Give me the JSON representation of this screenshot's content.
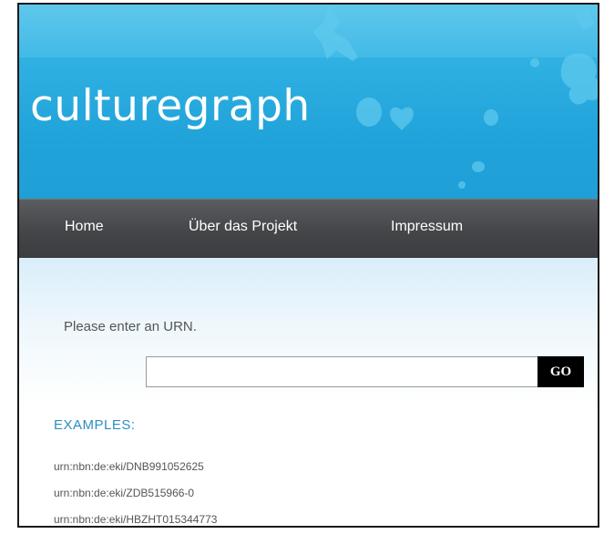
{
  "header": {
    "site_title": "culturegraph"
  },
  "nav": {
    "items": [
      {
        "label": "Home"
      },
      {
        "label": "Über das Projekt"
      },
      {
        "label": "Impressum"
      }
    ]
  },
  "search": {
    "prompt": "Please enter an URN.",
    "value": "",
    "go_label": "GO"
  },
  "examples": {
    "title": "EXAMPLES:",
    "items": [
      {
        "urn": "urn:nbn:de:eki/DNB991052625"
      },
      {
        "urn": "urn:nbn:de:eki/ZDB515966-0"
      },
      {
        "urn": "urn:nbn:de:eki/HBZHT015344773"
      }
    ]
  },
  "colors": {
    "header_blue": "#20a3da",
    "nav_gray": "#45474a",
    "examples_blue": "#2c8fc0",
    "button_black": "#000000"
  }
}
